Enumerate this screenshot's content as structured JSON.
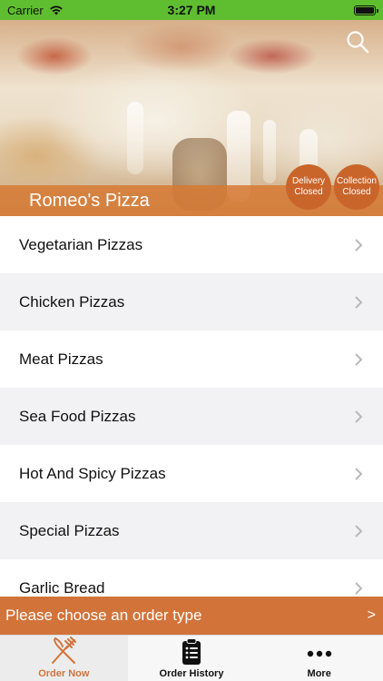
{
  "status_bar": {
    "carrier": "Carrier",
    "time": "3:27 PM"
  },
  "header": {
    "restaurant_name": "Romeo's Pizza",
    "delivery_badge": {
      "line1": "Delivery",
      "line2": "Closed"
    },
    "collection_badge": {
      "line1": "Collection",
      "line2": "Closed"
    },
    "search_icon": "search-icon"
  },
  "categories": [
    {
      "label": "Vegetarian Pizzas"
    },
    {
      "label": "Chicken Pizzas"
    },
    {
      "label": "Meat Pizzas"
    },
    {
      "label": "Sea Food Pizzas"
    },
    {
      "label": "Hot And Spicy Pizzas"
    },
    {
      "label": "Special Pizzas"
    },
    {
      "label": "Garlic Bread"
    }
  ],
  "order_bar": {
    "text": "Please choose an order type",
    "arrow": ">"
  },
  "tabs": [
    {
      "label": "Order Now",
      "icon": "fork-knife-icon",
      "active": true
    },
    {
      "label": "Order History",
      "icon": "clipboard-list-icon",
      "active": false
    },
    {
      "label": "More",
      "icon": "more-dots-icon",
      "active": false
    }
  ],
  "colors": {
    "status_bar": "#5fbe2f",
    "accent": "#d2733a",
    "badge": "#c9652b"
  }
}
